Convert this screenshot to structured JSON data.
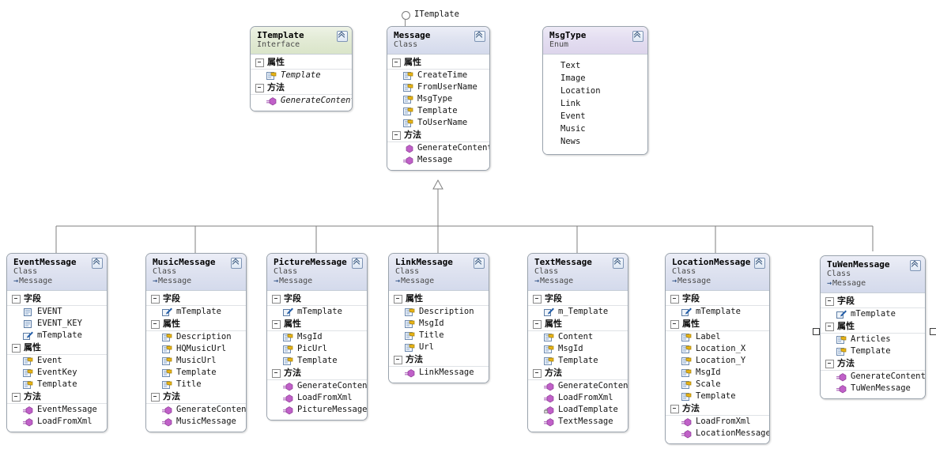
{
  "diagram": {
    "kind": "uml-class-diagram",
    "interface_connector_label": "ITemplate",
    "section_labels": {
      "fields": "字段",
      "properties": "属性",
      "methods": "方法"
    },
    "stereotypes": {
      "class": "Class",
      "interface": "Interface",
      "enum": "Enum"
    }
  },
  "nodes": {
    "itemplate": {
      "name": "ITemplate",
      "stereotype": "Interface",
      "sections": [
        {
          "label": "属性",
          "members": [
            {
              "name": "Template",
              "icon": "property-icon",
              "italic": true
            }
          ]
        },
        {
          "label": "方法",
          "members": [
            {
              "name": "GenerateContent",
              "icon": "method-icon",
              "italic": true
            }
          ]
        }
      ]
    },
    "message": {
      "name": "Message",
      "stereotype": "Class",
      "sections": [
        {
          "label": "属性",
          "members": [
            {
              "name": "CreateTime",
              "icon": "property-icon"
            },
            {
              "name": "FromUserName",
              "icon": "property-icon"
            },
            {
              "name": "MsgType",
              "icon": "property-icon"
            },
            {
              "name": "Template",
              "icon": "property-icon"
            },
            {
              "name": "ToUserName",
              "icon": "property-icon"
            }
          ]
        },
        {
          "label": "方法",
          "members": [
            {
              "name": "GenerateContent",
              "icon": "method-icon"
            },
            {
              "name": "Message",
              "icon": "method-icon"
            }
          ]
        }
      ]
    },
    "msgtype": {
      "name": "MsgType",
      "stereotype": "Enum",
      "literals": [
        "Text",
        "Image",
        "Location",
        "Link",
        "Event",
        "Music",
        "News"
      ]
    },
    "eventmessage": {
      "name": "EventMessage",
      "stereotype": "Class",
      "base": "Message",
      "sections": [
        {
          "label": "字段",
          "members": [
            {
              "name": "EVENT",
              "icon": "field-icon"
            },
            {
              "name": "EVENT_KEY",
              "icon": "field-icon"
            },
            {
              "name": "mTemplate",
              "icon": "field-private-icon"
            }
          ]
        },
        {
          "label": "属性",
          "members": [
            {
              "name": "Event",
              "icon": "property-icon"
            },
            {
              "name": "EventKey",
              "icon": "property-icon"
            },
            {
              "name": "Template",
              "icon": "property-icon"
            }
          ]
        },
        {
          "label": "方法",
          "members": [
            {
              "name": "EventMessage",
              "icon": "method-icon"
            },
            {
              "name": "LoadFromXml",
              "icon": "method-icon"
            }
          ]
        }
      ]
    },
    "musicmessage": {
      "name": "MusicMessage",
      "stereotype": "Class",
      "base": "Message",
      "sections": [
        {
          "label": "字段",
          "members": [
            {
              "name": "mTemplate",
              "icon": "field-private-icon"
            }
          ]
        },
        {
          "label": "属性",
          "members": [
            {
              "name": "Description",
              "icon": "property-icon"
            },
            {
              "name": "HQMusicUrl",
              "icon": "property-icon"
            },
            {
              "name": "MusicUrl",
              "icon": "property-icon"
            },
            {
              "name": "Template",
              "icon": "property-icon"
            },
            {
              "name": "Title",
              "icon": "property-icon"
            }
          ]
        },
        {
          "label": "方法",
          "members": [
            {
              "name": "GenerateContent",
              "icon": "method-icon"
            },
            {
              "name": "MusicMessage",
              "icon": "method-icon"
            }
          ]
        }
      ]
    },
    "picturemessage": {
      "name": "PictureMessage",
      "stereotype": "Class",
      "base": "Message",
      "sections": [
        {
          "label": "字段",
          "members": [
            {
              "name": "mTemplate",
              "icon": "field-private-icon"
            }
          ]
        },
        {
          "label": "属性",
          "members": [
            {
              "name": "MsgId",
              "icon": "property-icon"
            },
            {
              "name": "PicUrl",
              "icon": "property-icon"
            },
            {
              "name": "Template",
              "icon": "property-icon"
            }
          ]
        },
        {
          "label": "方法",
          "members": [
            {
              "name": "GenerateContent",
              "icon": "method-icon"
            },
            {
              "name": "LoadFromXml",
              "icon": "method-icon"
            },
            {
              "name": "PictureMessage",
              "icon": "method-icon"
            }
          ]
        }
      ]
    },
    "linkmessage": {
      "name": "LinkMessage",
      "stereotype": "Class",
      "base": "Message",
      "sections": [
        {
          "label": "属性",
          "members": [
            {
              "name": "Description",
              "icon": "property-icon"
            },
            {
              "name": "MsgId",
              "icon": "property-icon"
            },
            {
              "name": "Title",
              "icon": "property-icon"
            },
            {
              "name": "Url",
              "icon": "property-icon"
            }
          ]
        },
        {
          "label": "方法",
          "members": [
            {
              "name": "LinkMessage",
              "icon": "method-icon"
            }
          ]
        }
      ]
    },
    "textmessage": {
      "name": "TextMessage",
      "stereotype": "Class",
      "base": "Message",
      "sections": [
        {
          "label": "字段",
          "members": [
            {
              "name": "m_Template",
              "icon": "field-private-icon"
            }
          ]
        },
        {
          "label": "属性",
          "members": [
            {
              "name": "Content",
              "icon": "property-icon"
            },
            {
              "name": "MsgId",
              "icon": "property-icon"
            },
            {
              "name": "Template",
              "icon": "property-icon"
            }
          ]
        },
        {
          "label": "方法",
          "members": [
            {
              "name": "GenerateContent",
              "icon": "method-icon"
            },
            {
              "name": "LoadFromXml",
              "icon": "method-icon"
            },
            {
              "name": "LoadTemplate",
              "icon": "method-locked-icon"
            },
            {
              "name": "TextMessage",
              "icon": "method-icon"
            }
          ]
        }
      ]
    },
    "locationmessage": {
      "name": "LocationMessage",
      "stereotype": "Class",
      "base": "Message",
      "sections": [
        {
          "label": "字段",
          "members": [
            {
              "name": "mTemplate",
              "icon": "field-private-icon"
            }
          ]
        },
        {
          "label": "属性",
          "members": [
            {
              "name": "Label",
              "icon": "property-icon"
            },
            {
              "name": "Location_X",
              "icon": "property-icon"
            },
            {
              "name": "Location_Y",
              "icon": "property-icon"
            },
            {
              "name": "MsgId",
              "icon": "property-icon"
            },
            {
              "name": "Scale",
              "icon": "property-icon"
            },
            {
              "name": "Template",
              "icon": "property-icon"
            }
          ]
        },
        {
          "label": "方法",
          "members": [
            {
              "name": "LoadFromXml",
              "icon": "method-icon"
            },
            {
              "name": "LocationMessage",
              "icon": "method-icon"
            }
          ]
        }
      ]
    },
    "tuwenmessage": {
      "name": "TuWenMessage",
      "stereotype": "Class",
      "base": "Message",
      "selected": true,
      "sections": [
        {
          "label": "字段",
          "members": [
            {
              "name": "mTemplate",
              "icon": "field-private-icon"
            }
          ]
        },
        {
          "label": "属性",
          "members": [
            {
              "name": "Articles",
              "icon": "property-icon"
            },
            {
              "name": "Template",
              "icon": "property-icon"
            }
          ]
        },
        {
          "label": "方法",
          "members": [
            {
              "name": "GenerateContent",
              "icon": "method-icon"
            },
            {
              "name": "TuWenMessage",
              "icon": "method-icon"
            }
          ]
        }
      ]
    }
  },
  "colors": {
    "class_header": "#dfe3f0",
    "interface_header": "#e3ebd6",
    "enum_header": "#e4def1",
    "border": "#9aa3ad",
    "connector": "#8a8a8a",
    "property_icon": "#e8b417",
    "method_icon": "#c060c8",
    "field_icon": "#8aa4c8"
  }
}
